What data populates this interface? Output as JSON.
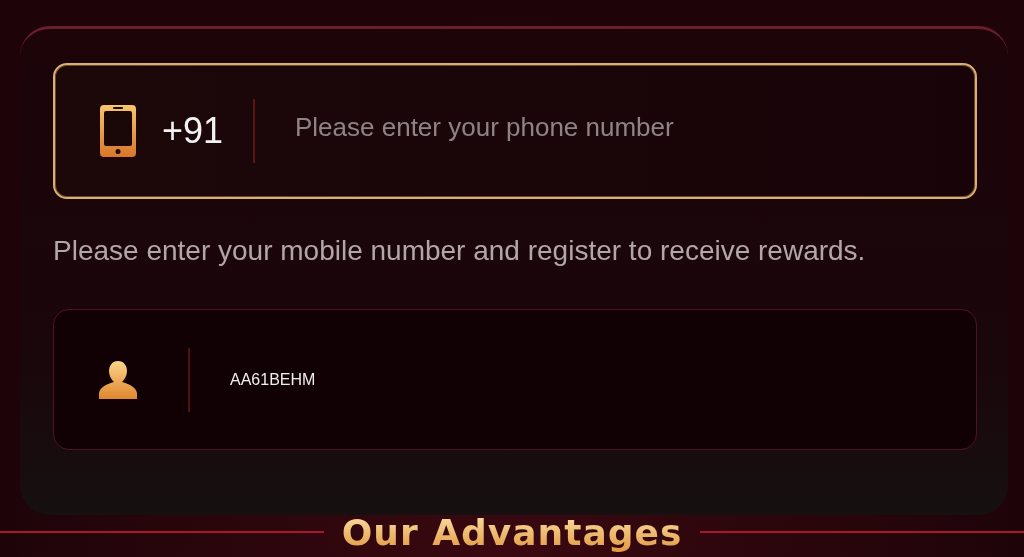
{
  "phone_field": {
    "country_code": "+91",
    "placeholder": "Please enter your phone number"
  },
  "hint": "Please enter your mobile number and register to receive rewards.",
  "invite_field": {
    "value": "AA61BEHM"
  },
  "section_title": "Our Advantages"
}
